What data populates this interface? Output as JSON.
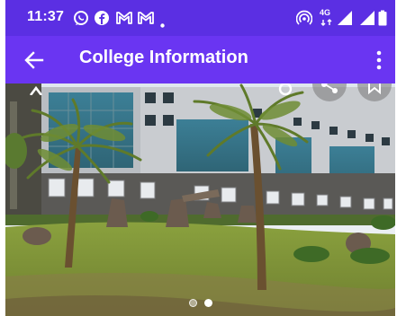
{
  "status_bar": {
    "time": "11:37",
    "left_icons": [
      "whatsapp-icon",
      "facebook-icon",
      "gmail-icon",
      "gmail-icon",
      "dot-icon"
    ],
    "right_icons": [
      "hotspot-icon",
      "4g-icon",
      "signal-icon",
      "signal-icon",
      "battery-icon"
    ],
    "network_label": "4G"
  },
  "app_bar": {
    "title": "College Information",
    "back_icon": "arrow-left-icon",
    "menu_icon": "more-vertical-icon",
    "color": "#6a35f2"
  },
  "gallery": {
    "image_description_icon": "college-building-photo",
    "overlay_buttons": [
      "share-icon",
      "bookmark-icon"
    ],
    "current_index": 1,
    "total": 2
  },
  "colors": {
    "status_bar": "#5b2fe3",
    "app_bar": "#6a35f2"
  }
}
